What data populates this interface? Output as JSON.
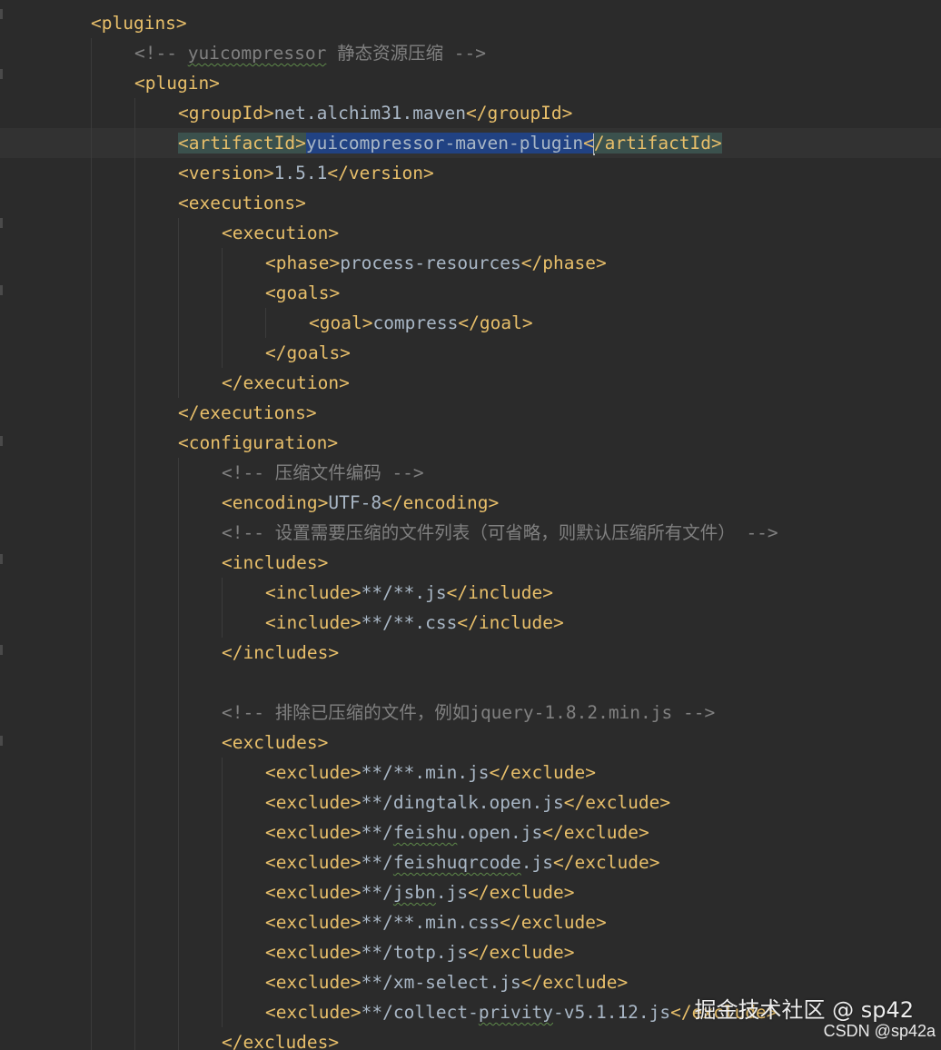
{
  "editor": {
    "lines": [
      {
        "indent": 2,
        "tokens": [
          {
            "t": "tag",
            "v": "<plugins>"
          }
        ]
      },
      {
        "indent": 3,
        "tokens": [
          {
            "t": "comment",
            "v": "<!-- "
          },
          {
            "t": "comment",
            "v": "yuicompressor",
            "squiggle": true
          },
          {
            "t": "comment",
            "v": " 静态资源压缩 -->"
          }
        ]
      },
      {
        "indent": 3,
        "tokens": [
          {
            "t": "tag",
            "v": "<plugin>"
          }
        ]
      },
      {
        "indent": 4,
        "tokens": [
          {
            "t": "tag",
            "v": "<groupId>"
          },
          {
            "t": "text",
            "v": "net.alchim31.maven"
          },
          {
            "t": "tag",
            "v": "</groupId>"
          }
        ]
      },
      {
        "indent": 4,
        "current": true,
        "tokens": [
          {
            "t": "tag",
            "v": "<artifactId>",
            "hl": true
          },
          {
            "t": "text",
            "v": "yuicompressor-maven-plugin",
            "sel": true
          },
          {
            "t": "tag",
            "v": "<",
            "sel": true,
            "hl": true
          },
          {
            "t": "caret"
          },
          {
            "t": "tag",
            "v": "/artifactId>",
            "hl": true
          }
        ]
      },
      {
        "indent": 4,
        "tokens": [
          {
            "t": "tag",
            "v": "<version>"
          },
          {
            "t": "text",
            "v": "1.5.1"
          },
          {
            "t": "tag",
            "v": "</version>"
          }
        ]
      },
      {
        "indent": 4,
        "tokens": [
          {
            "t": "tag",
            "v": "<executions>"
          }
        ]
      },
      {
        "indent": 5,
        "tokens": [
          {
            "t": "tag",
            "v": "<execution>"
          }
        ]
      },
      {
        "indent": 6,
        "tokens": [
          {
            "t": "tag",
            "v": "<phase>"
          },
          {
            "t": "text",
            "v": "process-resources"
          },
          {
            "t": "tag",
            "v": "</phase>"
          }
        ]
      },
      {
        "indent": 6,
        "tokens": [
          {
            "t": "tag",
            "v": "<goals>"
          }
        ]
      },
      {
        "indent": 7,
        "tokens": [
          {
            "t": "tag",
            "v": "<goal>"
          },
          {
            "t": "text",
            "v": "compress"
          },
          {
            "t": "tag",
            "v": "</goal>"
          }
        ]
      },
      {
        "indent": 6,
        "tokens": [
          {
            "t": "tag",
            "v": "</goals>"
          }
        ]
      },
      {
        "indent": 5,
        "tokens": [
          {
            "t": "tag",
            "v": "</execution>"
          }
        ]
      },
      {
        "indent": 4,
        "tokens": [
          {
            "t": "tag",
            "v": "</executions>"
          }
        ]
      },
      {
        "indent": 4,
        "tokens": [
          {
            "t": "tag",
            "v": "<configuration>"
          }
        ]
      },
      {
        "indent": 5,
        "tokens": [
          {
            "t": "comment",
            "v": "<!-- 压缩文件编码 -->"
          }
        ]
      },
      {
        "indent": 5,
        "tokens": [
          {
            "t": "tag",
            "v": "<encoding>"
          },
          {
            "t": "text",
            "v": "UTF-8"
          },
          {
            "t": "tag",
            "v": "</encoding>"
          }
        ]
      },
      {
        "indent": 5,
        "tokens": [
          {
            "t": "comment",
            "v": "<!-- 设置需要压缩的文件列表（可省略，则默认压缩所有文件） -->"
          }
        ]
      },
      {
        "indent": 5,
        "tokens": [
          {
            "t": "tag",
            "v": "<includes>"
          }
        ]
      },
      {
        "indent": 6,
        "tokens": [
          {
            "t": "tag",
            "v": "<include>"
          },
          {
            "t": "text",
            "v": "**/**.js"
          },
          {
            "t": "tag",
            "v": "</include>"
          }
        ]
      },
      {
        "indent": 6,
        "tokens": [
          {
            "t": "tag",
            "v": "<include>"
          },
          {
            "t": "text",
            "v": "**/**.css"
          },
          {
            "t": "tag",
            "v": "</include>"
          }
        ]
      },
      {
        "indent": 5,
        "tokens": [
          {
            "t": "tag",
            "v": "</includes>"
          }
        ]
      },
      {
        "indent": 5,
        "tokens": []
      },
      {
        "indent": 5,
        "tokens": [
          {
            "t": "comment",
            "v": "<!-- 排除已压缩的文件，例如jquery-1.8.2.min.js -->"
          }
        ]
      },
      {
        "indent": 5,
        "tokens": [
          {
            "t": "tag",
            "v": "<excludes>"
          }
        ]
      },
      {
        "indent": 6,
        "tokens": [
          {
            "t": "tag",
            "v": "<exclude>"
          },
          {
            "t": "text",
            "v": "**/**.min.js"
          },
          {
            "t": "tag",
            "v": "</exclude>"
          }
        ]
      },
      {
        "indent": 6,
        "tokens": [
          {
            "t": "tag",
            "v": "<exclude>"
          },
          {
            "t": "text",
            "v": "**/dingtalk.open.js"
          },
          {
            "t": "tag",
            "v": "</exclude>"
          }
        ]
      },
      {
        "indent": 6,
        "tokens": [
          {
            "t": "tag",
            "v": "<exclude>"
          },
          {
            "t": "text",
            "v": "**/"
          },
          {
            "t": "text",
            "v": "feishu",
            "squiggle": true
          },
          {
            "t": "text",
            "v": ".open.js"
          },
          {
            "t": "tag",
            "v": "</exclude>"
          }
        ]
      },
      {
        "indent": 6,
        "tokens": [
          {
            "t": "tag",
            "v": "<exclude>"
          },
          {
            "t": "text",
            "v": "**/"
          },
          {
            "t": "text",
            "v": "feishuqrcode",
            "squiggle": true
          },
          {
            "t": "text",
            "v": ".js"
          },
          {
            "t": "tag",
            "v": "</exclude>"
          }
        ]
      },
      {
        "indent": 6,
        "tokens": [
          {
            "t": "tag",
            "v": "<exclude>"
          },
          {
            "t": "text",
            "v": "**/"
          },
          {
            "t": "text",
            "v": "jsbn",
            "squiggle": true
          },
          {
            "t": "text",
            "v": ".js"
          },
          {
            "t": "tag",
            "v": "</exclude>"
          }
        ]
      },
      {
        "indent": 6,
        "tokens": [
          {
            "t": "tag",
            "v": "<exclude>"
          },
          {
            "t": "text",
            "v": "**/**.min.css"
          },
          {
            "t": "tag",
            "v": "</exclude>"
          }
        ]
      },
      {
        "indent": 6,
        "tokens": [
          {
            "t": "tag",
            "v": "<exclude>"
          },
          {
            "t": "text",
            "v": "**/totp.js"
          },
          {
            "t": "tag",
            "v": "</exclude>"
          }
        ]
      },
      {
        "indent": 6,
        "tokens": [
          {
            "t": "tag",
            "v": "<exclude>"
          },
          {
            "t": "text",
            "v": "**/xm-select.js"
          },
          {
            "t": "tag",
            "v": "</exclude>"
          }
        ]
      },
      {
        "indent": 6,
        "tokens": [
          {
            "t": "tag",
            "v": "<exclude>"
          },
          {
            "t": "text",
            "v": "**/collect-"
          },
          {
            "t": "text",
            "v": "privity",
            "squiggle": true
          },
          {
            "t": "text",
            "v": "-v5.1.12.js"
          },
          {
            "t": "tag",
            "v": "</exclude>"
          }
        ]
      },
      {
        "indent": 5,
        "tokens": [
          {
            "t": "tag",
            "v": "</excludes>"
          }
        ]
      }
    ]
  },
  "watermark": {
    "primary": "掘金技术社区 @ sp42",
    "secondary": "CSDN @sp42a"
  }
}
